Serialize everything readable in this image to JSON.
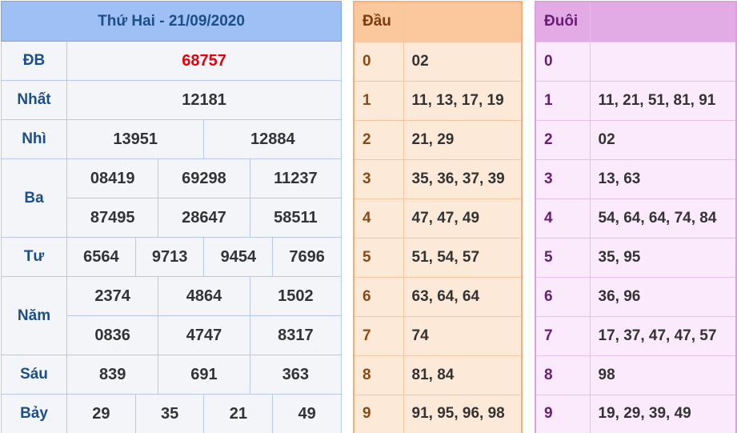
{
  "results": {
    "title": "Thứ Hai - 21/09/2020",
    "prizes": {
      "db": {
        "label": "ĐB",
        "numbers": [
          "68757"
        ]
      },
      "nhat": {
        "label": "Nhất",
        "numbers": [
          "12181"
        ]
      },
      "nhi": {
        "label": "Nhì",
        "numbers": [
          "13951",
          "12884"
        ]
      },
      "ba": {
        "label": "Ba",
        "numbers": [
          "08419",
          "69298",
          "11237",
          "87495",
          "28647",
          "58511"
        ]
      },
      "tu": {
        "label": "Tư",
        "numbers": [
          "6564",
          "9713",
          "9454",
          "7696"
        ]
      },
      "nam": {
        "label": "Năm",
        "numbers": [
          "2374",
          "4864",
          "1502",
          "0836",
          "4747",
          "8317"
        ]
      },
      "sau": {
        "label": "Sáu",
        "numbers": [
          "839",
          "691",
          "363"
        ]
      },
      "bay": {
        "label": "Bảy",
        "numbers": [
          "29",
          "35",
          "21",
          "49"
        ]
      }
    }
  },
  "dau": {
    "header": "Đầu",
    "rows": [
      {
        "digit": "0",
        "values": "02"
      },
      {
        "digit": "1",
        "values": "11, 13, 17, 19"
      },
      {
        "digit": "2",
        "values": "21, 29"
      },
      {
        "digit": "3",
        "values": "35, 36, 37, 39"
      },
      {
        "digit": "4",
        "values": "47, 47, 49"
      },
      {
        "digit": "5",
        "values": "51, 54, 57"
      },
      {
        "digit": "6",
        "values": "63, 64, 64"
      },
      {
        "digit": "7",
        "values": "74"
      },
      {
        "digit": "8",
        "values": "81, 84"
      },
      {
        "digit": "9",
        "values": "91, 95, 96, 98"
      }
    ]
  },
  "duoi": {
    "header": "Đuôi",
    "rows": [
      {
        "digit": "0",
        "values": ""
      },
      {
        "digit": "1",
        "values": "11, 21, 51, 81, 91"
      },
      {
        "digit": "2",
        "values": "02"
      },
      {
        "digit": "3",
        "values": "13, 63"
      },
      {
        "digit": "4",
        "values": "54, 64, 64, 74, 84"
      },
      {
        "digit": "5",
        "values": "35, 95"
      },
      {
        "digit": "6",
        "values": "36, 96"
      },
      {
        "digit": "7",
        "values": "17, 37, 47, 47, 57"
      },
      {
        "digit": "8",
        "values": "98"
      },
      {
        "digit": "9",
        "values": "19, 29, 39, 49"
      }
    ]
  },
  "colors": {
    "special_prize": "#e8000b",
    "results_header": "#9ec0f5",
    "dau_header": "#fbc79d",
    "duoi_header": "#e2abe5"
  }
}
